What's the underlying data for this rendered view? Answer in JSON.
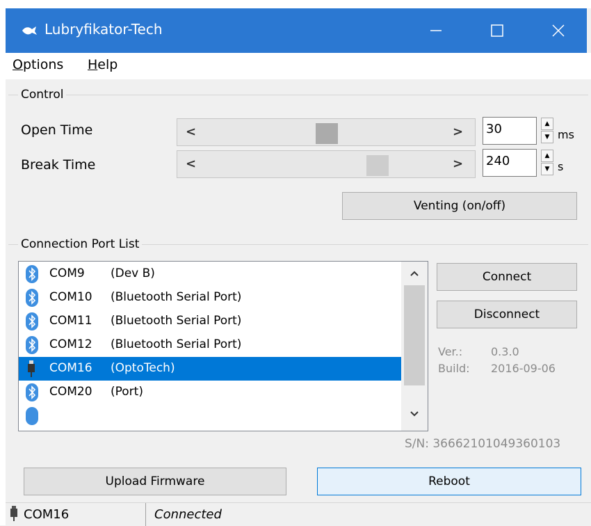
{
  "window": {
    "title": "Lubryfikator-Tech",
    "titlebar_color": "#2b78d2",
    "min_icon": "minimize-icon",
    "max_icon": "maximize-icon",
    "close_icon": "close-icon"
  },
  "menu": {
    "options_u": "O",
    "options_rest": "ptions",
    "help_u": "H",
    "help_rest": "elp"
  },
  "control": {
    "group_title": "Control",
    "open_time_label": "Open Time",
    "open_time_value": "30",
    "open_time_unit": "ms",
    "open_time_slider_fraction": 0.5,
    "break_time_label": "Break Time",
    "break_time_value": "240",
    "break_time_unit": "s",
    "break_time_slider_fraction": 0.73,
    "venting_button": "Venting (on/off)"
  },
  "ports": {
    "group_title": "Connection Port List",
    "items": [
      {
        "com": "COM9",
        "desc": "(Dev B)",
        "icon": "bluetooth-icon"
      },
      {
        "com": "COM10",
        "desc": "(Bluetooth Serial Port)",
        "icon": "bluetooth-icon"
      },
      {
        "com": "COM11",
        "desc": "(Bluetooth Serial Port)",
        "icon": "bluetooth-icon"
      },
      {
        "com": "COM12",
        "desc": "(Bluetooth Serial Port)",
        "icon": "bluetooth-icon"
      },
      {
        "com": "COM16",
        "desc": "(OptoTech)",
        "icon": "usb-plug-icon",
        "selected": true
      },
      {
        "com": "COM20",
        "desc": "(Port)",
        "icon": "bluetooth-icon"
      }
    ],
    "connect_button": "Connect",
    "disconnect_button": "Disconnect",
    "ver_label": "Ver.:",
    "ver_value": "0.3.0",
    "build_label": "Build:",
    "build_value": "2016-09-06",
    "serial": "S/N: 36662101049360103"
  },
  "actions": {
    "upload_firmware": "Upload Firmware",
    "reboot": "Reboot"
  },
  "status": {
    "port": "COM16",
    "state": "Connected"
  }
}
